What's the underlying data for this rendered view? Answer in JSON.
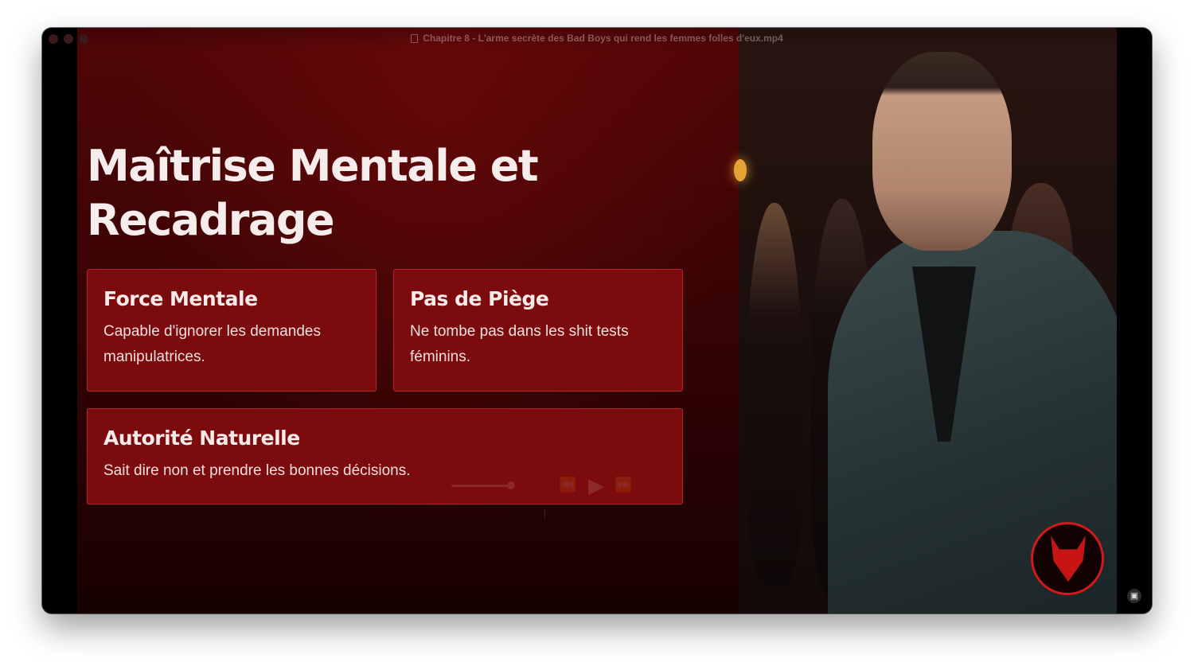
{
  "window": {
    "title": "Chapitre 8 - L'arme secrète des Bad Boys qui rend les femmes folles d'eux.mp4"
  },
  "slide": {
    "heading": "Maîtrise Mentale et Recadrage",
    "cards": [
      {
        "title": "Force Mentale",
        "text": "Capable d'ignorer les demandes manipulatrices."
      },
      {
        "title": "Pas de Piège",
        "text": "Ne tombe pas dans les shit tests féminins."
      },
      {
        "title": "Autorité Naturelle",
        "text": "Sait dire non et prendre les bonnes décisions."
      }
    ]
  },
  "icons": {
    "document": "document-icon",
    "rewind": "rewind-icon",
    "play": "play-icon",
    "fast_forward": "fast-forward-icon",
    "live_text": "live-text-icon",
    "logo": "wolf-logo"
  },
  "colors": {
    "card_background": "#7c0b0d",
    "card_border": "#b0262a",
    "panel_background": "#3f0405",
    "heading_text": "#f6ecec",
    "logo_accent": "#d21a1a"
  }
}
